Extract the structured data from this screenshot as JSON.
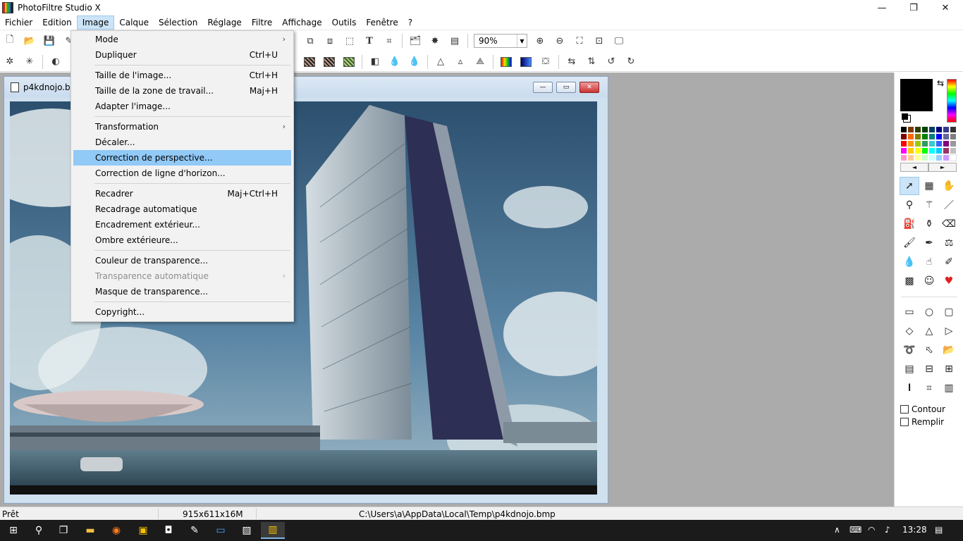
{
  "window": {
    "title": "PhotoFiltre Studio X",
    "minimize": "—",
    "maximize": "❐",
    "close": "✕"
  },
  "menubar": [
    "Fichier",
    "Edition",
    "Image",
    "Calque",
    "Sélection",
    "Réglage",
    "Filtre",
    "Affichage",
    "Outils",
    "Fenêtre",
    "?"
  ],
  "toolbar": {
    "zoom": "90%",
    "zoom_arrow": "▼"
  },
  "document": {
    "title": "p4kdnojo.bm",
    "min": "—",
    "max": "▭",
    "close": "✕"
  },
  "image_menu": [
    {
      "label": "Mode",
      "shortcut": "",
      "submenu": true
    },
    {
      "label": "Dupliquer",
      "shortcut": "Ctrl+U"
    },
    {
      "label": "Taille de l'image...",
      "shortcut": "Ctrl+H"
    },
    {
      "label": "Taille de la zone de travail...",
      "shortcut": "Maj+H"
    },
    {
      "label": "Adapter l'image...",
      "shortcut": ""
    },
    {
      "label": "Transformation",
      "shortcut": "",
      "submenu": true
    },
    {
      "label": "Décaler...",
      "shortcut": ""
    },
    {
      "label": "Correction de perspective...",
      "shortcut": "",
      "highlighted": true
    },
    {
      "label": "Correction de ligne d'horizon...",
      "shortcut": ""
    },
    {
      "label": "Recadrer",
      "shortcut": "Maj+Ctrl+H"
    },
    {
      "label": "Recadrage automatique",
      "shortcut": ""
    },
    {
      "label": "Encadrement extérieur...",
      "shortcut": ""
    },
    {
      "label": "Ombre extérieure...",
      "shortcut": ""
    },
    {
      "label": "Couleur de transparence...",
      "shortcut": ""
    },
    {
      "label": "Transparence automatique",
      "shortcut": "",
      "submenu": true,
      "disabled": true
    },
    {
      "label": "Masque de transparence...",
      "shortcut": ""
    },
    {
      "label": "Copyright...",
      "shortcut": ""
    }
  ],
  "tools": {
    "contour": "Contour",
    "remplir": "Remplir",
    "fg_color": "#000000",
    "pal_prev": "◄",
    "pal_next": "►"
  },
  "status": {
    "ready": "Prêt",
    "size": "915x611x16M",
    "path": "C:\\Users\\a\\AppData\\Local\\Temp\\p4kdnojo.bmp"
  },
  "taskbar": {
    "time": "13:28"
  }
}
